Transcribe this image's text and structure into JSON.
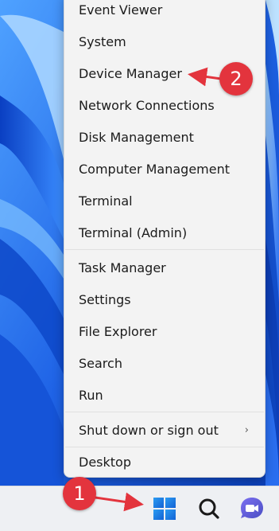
{
  "context_menu": {
    "items": [
      {
        "label": "Event Viewer",
        "name": "menu-item-event-viewer"
      },
      {
        "label": "System",
        "name": "menu-item-system"
      },
      {
        "label": "Device Manager",
        "name": "menu-item-device-manager"
      },
      {
        "label": "Network Connections",
        "name": "menu-item-network-connections"
      },
      {
        "label": "Disk Management",
        "name": "menu-item-disk-management"
      },
      {
        "label": "Computer Management",
        "name": "menu-item-computer-management"
      },
      {
        "label": "Terminal",
        "name": "menu-item-terminal"
      },
      {
        "label": "Terminal (Admin)",
        "name": "menu-item-terminal-admin"
      },
      {
        "label": "Task Manager",
        "name": "menu-item-task-manager"
      },
      {
        "label": "Settings",
        "name": "menu-item-settings"
      },
      {
        "label": "File Explorer",
        "name": "menu-item-file-explorer"
      },
      {
        "label": "Search",
        "name": "menu-item-search"
      },
      {
        "label": "Run",
        "name": "menu-item-run"
      },
      {
        "label": "Shut down or sign out",
        "name": "menu-item-shut-down-or-sign-out",
        "submenu": true
      },
      {
        "label": "Desktop",
        "name": "menu-item-desktop"
      }
    ],
    "submenu_glyph": "›"
  },
  "taskbar": {
    "buttons": [
      {
        "name": "start-button",
        "icon": "windows-logo-icon"
      },
      {
        "name": "search-button",
        "icon": "search-icon"
      },
      {
        "name": "chat-button",
        "icon": "teams-chat-icon"
      }
    ]
  },
  "annotations": {
    "step_1": "1",
    "step_2": "2",
    "color": "#e3343d"
  },
  "colors": {
    "menu_background": "#f3f3f3",
    "taskbar_background": "#eef0f3",
    "windows_logo": "#1e7fe0",
    "chat_icon": "#5b5fc7"
  }
}
